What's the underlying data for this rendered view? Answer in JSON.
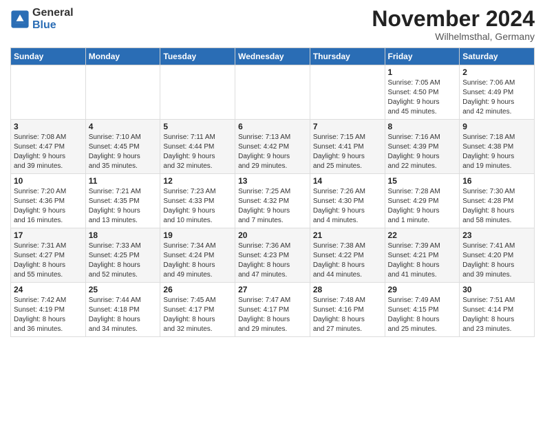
{
  "logo": {
    "general": "General",
    "blue": "Blue"
  },
  "title": "November 2024",
  "location": "Wilhelmsthal, Germany",
  "days_of_week": [
    "Sunday",
    "Monday",
    "Tuesday",
    "Wednesday",
    "Thursday",
    "Friday",
    "Saturday"
  ],
  "weeks": [
    [
      {
        "day": "",
        "info": ""
      },
      {
        "day": "",
        "info": ""
      },
      {
        "day": "",
        "info": ""
      },
      {
        "day": "",
        "info": ""
      },
      {
        "day": "",
        "info": ""
      },
      {
        "day": "1",
        "info": "Sunrise: 7:05 AM\nSunset: 4:50 PM\nDaylight: 9 hours\nand 45 minutes."
      },
      {
        "day": "2",
        "info": "Sunrise: 7:06 AM\nSunset: 4:49 PM\nDaylight: 9 hours\nand 42 minutes."
      }
    ],
    [
      {
        "day": "3",
        "info": "Sunrise: 7:08 AM\nSunset: 4:47 PM\nDaylight: 9 hours\nand 39 minutes."
      },
      {
        "day": "4",
        "info": "Sunrise: 7:10 AM\nSunset: 4:45 PM\nDaylight: 9 hours\nand 35 minutes."
      },
      {
        "day": "5",
        "info": "Sunrise: 7:11 AM\nSunset: 4:44 PM\nDaylight: 9 hours\nand 32 minutes."
      },
      {
        "day": "6",
        "info": "Sunrise: 7:13 AM\nSunset: 4:42 PM\nDaylight: 9 hours\nand 29 minutes."
      },
      {
        "day": "7",
        "info": "Sunrise: 7:15 AM\nSunset: 4:41 PM\nDaylight: 9 hours\nand 25 minutes."
      },
      {
        "day": "8",
        "info": "Sunrise: 7:16 AM\nSunset: 4:39 PM\nDaylight: 9 hours\nand 22 minutes."
      },
      {
        "day": "9",
        "info": "Sunrise: 7:18 AM\nSunset: 4:38 PM\nDaylight: 9 hours\nand 19 minutes."
      }
    ],
    [
      {
        "day": "10",
        "info": "Sunrise: 7:20 AM\nSunset: 4:36 PM\nDaylight: 9 hours\nand 16 minutes."
      },
      {
        "day": "11",
        "info": "Sunrise: 7:21 AM\nSunset: 4:35 PM\nDaylight: 9 hours\nand 13 minutes."
      },
      {
        "day": "12",
        "info": "Sunrise: 7:23 AM\nSunset: 4:33 PM\nDaylight: 9 hours\nand 10 minutes."
      },
      {
        "day": "13",
        "info": "Sunrise: 7:25 AM\nSunset: 4:32 PM\nDaylight: 9 hours\nand 7 minutes."
      },
      {
        "day": "14",
        "info": "Sunrise: 7:26 AM\nSunset: 4:30 PM\nDaylight: 9 hours\nand 4 minutes."
      },
      {
        "day": "15",
        "info": "Sunrise: 7:28 AM\nSunset: 4:29 PM\nDaylight: 9 hours\nand 1 minute."
      },
      {
        "day": "16",
        "info": "Sunrise: 7:30 AM\nSunset: 4:28 PM\nDaylight: 8 hours\nand 58 minutes."
      }
    ],
    [
      {
        "day": "17",
        "info": "Sunrise: 7:31 AM\nSunset: 4:27 PM\nDaylight: 8 hours\nand 55 minutes."
      },
      {
        "day": "18",
        "info": "Sunrise: 7:33 AM\nSunset: 4:25 PM\nDaylight: 8 hours\nand 52 minutes."
      },
      {
        "day": "19",
        "info": "Sunrise: 7:34 AM\nSunset: 4:24 PM\nDaylight: 8 hours\nand 49 minutes."
      },
      {
        "day": "20",
        "info": "Sunrise: 7:36 AM\nSunset: 4:23 PM\nDaylight: 8 hours\nand 47 minutes."
      },
      {
        "day": "21",
        "info": "Sunrise: 7:38 AM\nSunset: 4:22 PM\nDaylight: 8 hours\nand 44 minutes."
      },
      {
        "day": "22",
        "info": "Sunrise: 7:39 AM\nSunset: 4:21 PM\nDaylight: 8 hours\nand 41 minutes."
      },
      {
        "day": "23",
        "info": "Sunrise: 7:41 AM\nSunset: 4:20 PM\nDaylight: 8 hours\nand 39 minutes."
      }
    ],
    [
      {
        "day": "24",
        "info": "Sunrise: 7:42 AM\nSunset: 4:19 PM\nDaylight: 8 hours\nand 36 minutes."
      },
      {
        "day": "25",
        "info": "Sunrise: 7:44 AM\nSunset: 4:18 PM\nDaylight: 8 hours\nand 34 minutes."
      },
      {
        "day": "26",
        "info": "Sunrise: 7:45 AM\nSunset: 4:17 PM\nDaylight: 8 hours\nand 32 minutes."
      },
      {
        "day": "27",
        "info": "Sunrise: 7:47 AM\nSunset: 4:17 PM\nDaylight: 8 hours\nand 29 minutes."
      },
      {
        "day": "28",
        "info": "Sunrise: 7:48 AM\nSunset: 4:16 PM\nDaylight: 8 hours\nand 27 minutes."
      },
      {
        "day": "29",
        "info": "Sunrise: 7:49 AM\nSunset: 4:15 PM\nDaylight: 8 hours\nand 25 minutes."
      },
      {
        "day": "30",
        "info": "Sunrise: 7:51 AM\nSunset: 4:14 PM\nDaylight: 8 hours\nand 23 minutes."
      }
    ]
  ]
}
